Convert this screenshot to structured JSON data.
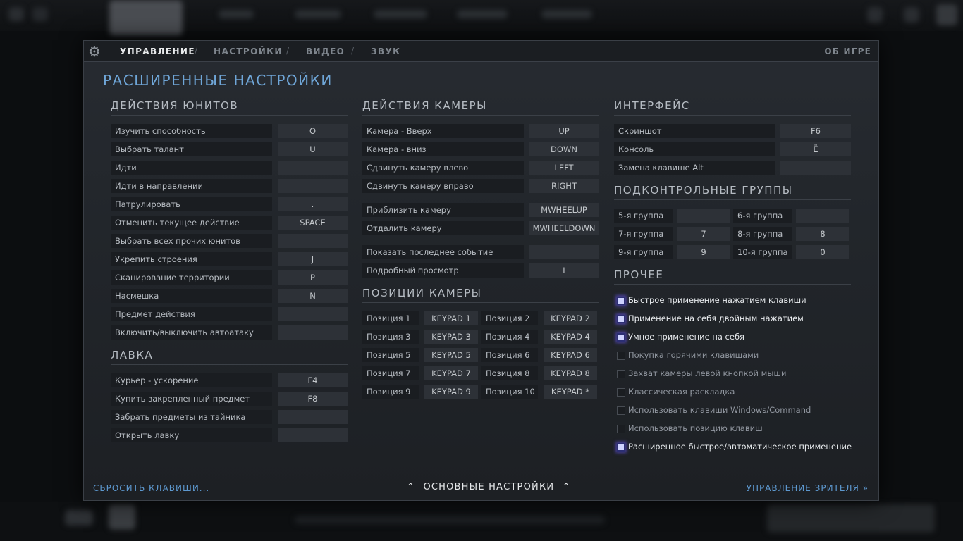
{
  "tabs": {
    "controls": "УПРАВЛЕНИЕ",
    "settings": "НАСТРОЙКИ",
    "video": "ВИДЕО",
    "sound": "ЗВУК",
    "separator": "/",
    "about": "ОБ ИГРЕ"
  },
  "title": "РАСШИРЕННЫЕ НАСТРОЙКИ",
  "units": {
    "title": "ДЕЙСТВИЯ ЮНИТОВ",
    "rows": [
      {
        "label": "Изучить способность",
        "key": "O"
      },
      {
        "label": "Выбрать талант",
        "key": "U"
      },
      {
        "label": "Идти",
        "key": ""
      },
      {
        "label": "Идти в направлении",
        "key": ""
      },
      {
        "label": "Патрулировать",
        "key": "."
      },
      {
        "label": "Отменить текущее действие",
        "key": "SPACE"
      },
      {
        "label": "Выбрать всех прочих юнитов",
        "key": ""
      },
      {
        "label": "Укрепить строения",
        "key": "J"
      },
      {
        "label": "Сканирование территории",
        "key": "P"
      },
      {
        "label": "Насмешка",
        "key": "N"
      },
      {
        "label": "Предмет действия",
        "key": ""
      },
      {
        "label": "Включить/выключить автоатаку",
        "key": ""
      }
    ]
  },
  "shop": {
    "title": "ЛАВКА",
    "rows": [
      {
        "label": "Курьер - ускорение",
        "key": "F4"
      },
      {
        "label": "Купить закрепленный предмет",
        "key": "F8"
      },
      {
        "label": "Забрать предметы из тайника",
        "key": ""
      },
      {
        "label": "Открыть лавку",
        "key": ""
      }
    ]
  },
  "camera": {
    "title": "ДЕЙСТВИЯ КАМЕРЫ",
    "rows": [
      {
        "label": "Камера - Вверх",
        "key": "UP"
      },
      {
        "label": "Камера - вниз",
        "key": "DOWN"
      },
      {
        "label": "Сдвинуть камеру влево",
        "key": "LEFT"
      },
      {
        "label": "Сдвинуть камеру вправо",
        "key": "RIGHT"
      },
      {
        "label": "Приблизить камеру",
        "key": "MWHEELUP"
      },
      {
        "label": "Отдалить камеру",
        "key": "MWHEELDOWN"
      },
      {
        "label": "Показать последнее событие",
        "key": ""
      },
      {
        "label": "Подробный просмотр",
        "key": "I"
      }
    ]
  },
  "positions": {
    "title": "ПОЗИЦИИ КАМЕРЫ",
    "rows": [
      {
        "label": "Позиция 1",
        "key": "KEYPAD 1"
      },
      {
        "label": "Позиция 2",
        "key": "KEYPAD 2"
      },
      {
        "label": "Позиция 3",
        "key": "KEYPAD 3"
      },
      {
        "label": "Позиция 4",
        "key": "KEYPAD 4"
      },
      {
        "label": "Позиция 5",
        "key": "KEYPAD 5"
      },
      {
        "label": "Позиция 6",
        "key": "KEYPAD 6"
      },
      {
        "label": "Позиция 7",
        "key": "KEYPAD 7"
      },
      {
        "label": "Позиция 8",
        "key": "KEYPAD 8"
      },
      {
        "label": "Позиция 9",
        "key": "KEYPAD 9"
      },
      {
        "label": "Позиция 10",
        "key": "KEYPAD *"
      }
    ]
  },
  "interface": {
    "title": "ИНТЕРФЕЙС",
    "rows": [
      {
        "label": "Скриншот",
        "key": "F6"
      },
      {
        "label": "Консоль",
        "key": "Ё"
      },
      {
        "label": "Замена клавише Alt",
        "key": ""
      }
    ]
  },
  "groups": {
    "title": "ПОДКОНТРОЛЬНЫЕ ГРУППЫ",
    "rows": [
      {
        "label": "5-я группа",
        "key": ""
      },
      {
        "label": "6-я группа",
        "key": ""
      },
      {
        "label": "7-я группа",
        "key": "7"
      },
      {
        "label": "8-я группа",
        "key": "8"
      },
      {
        "label": "9-я группа",
        "key": "9"
      },
      {
        "label": "10-я группа",
        "key": "0"
      }
    ]
  },
  "other": {
    "title": "ПРОЧЕЕ",
    "items": [
      {
        "label": "Быстрое применение нажатием клавиши",
        "checked": true
      },
      {
        "label": "Применение на себя двойным нажатием",
        "checked": true
      },
      {
        "label": "Умное применение на себя",
        "checked": true
      },
      {
        "label": "Покупка горячими клавишами",
        "checked": false
      },
      {
        "label": "Захват камеры левой кнопкой мыши",
        "checked": false
      },
      {
        "label": "Классическая раскладка",
        "checked": false
      },
      {
        "label": "Использовать клавиши Windows/Command",
        "checked": false
      },
      {
        "label": "Использовать позицию клавиш",
        "checked": false
      },
      {
        "label": "Расширенное быстрое/автоматическое применение",
        "checked": true
      }
    ]
  },
  "footer": {
    "reset": "СБРОСИТЬ КЛАВИШИ...",
    "basic": "ОСНОВНЫЕ НАСТРОЙКИ",
    "spectator": "УПРАВЛЕНИЕ ЗРИТЕЛЯ"
  },
  "icons": {
    "gear": "gear-icon",
    "chevron_up": "chevron-up-icon",
    "double_chevron": "double-chevron-right-icon"
  },
  "colors": {
    "accent": "#6fa6d8",
    "checked": "#cfd3ff"
  }
}
